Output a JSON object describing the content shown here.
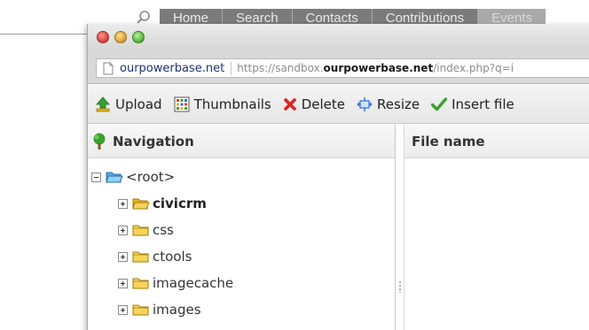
{
  "background_nav": {
    "items": [
      "Home",
      "Search",
      "Contacts",
      "Contributions",
      "Events"
    ]
  },
  "window": {
    "address": {
      "site_label": "ourpowerbase.net",
      "url_prefix": "https://sandbox.",
      "url_domain": "ourpowerbase.net",
      "url_suffix": "/index.php?q=i"
    },
    "toolbar": {
      "upload": "Upload",
      "thumbnails": "Thumbnails",
      "delete": "Delete",
      "resize": "Resize",
      "insert_file": "Insert file"
    },
    "navigation": {
      "title": "Navigation",
      "root": "<root>",
      "folders": [
        "civicrm",
        "css",
        "ctools",
        "imagecache",
        "images"
      ]
    },
    "files": {
      "column_file_name": "File name"
    }
  },
  "colors": {
    "nav_bar": "#7b7b7b",
    "folder": "#f0c419",
    "link_blue": "#1e2f7a",
    "delete_red": "#d9251d",
    "insert_green": "#3aa02d"
  }
}
